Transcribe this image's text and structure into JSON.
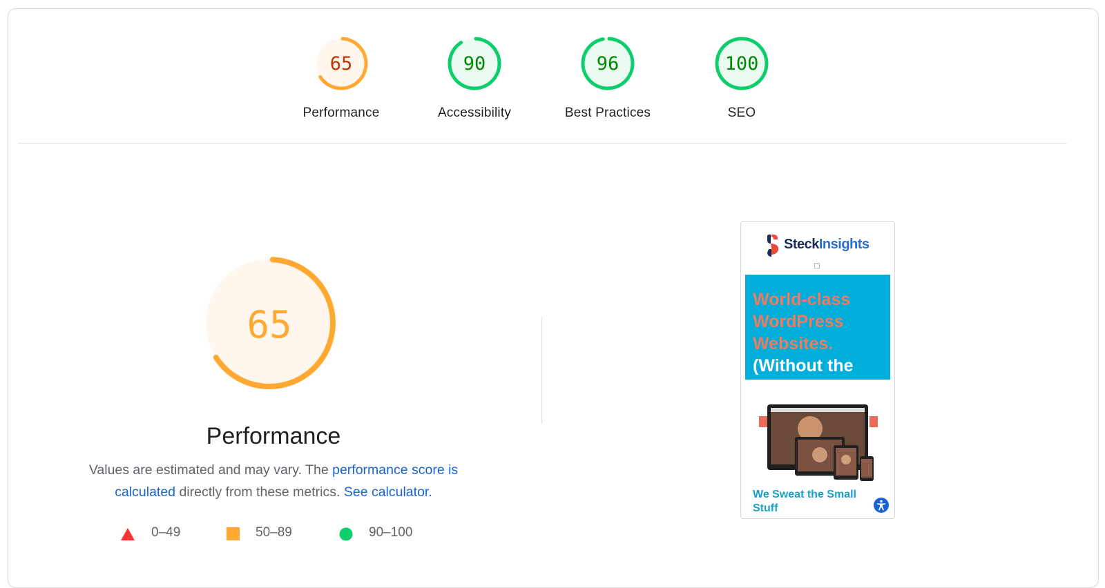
{
  "categories": [
    {
      "name": "Performance",
      "score": 65,
      "status": "average"
    },
    {
      "name": "Accessibility",
      "score": 90,
      "status": "pass"
    },
    {
      "name": "Best Practices",
      "score": 96,
      "status": "pass"
    },
    {
      "name": "SEO",
      "score": 100,
      "status": "pass"
    }
  ],
  "main": {
    "score": 65,
    "title": "Performance",
    "desc_prefix": "Values are estimated and may vary. The ",
    "desc_link": "performance score is calculated",
    "desc_middle": " directly from these metrics. ",
    "desc_calc_link": "See calculator.",
    "legend": [
      {
        "label": "0–49",
        "icon": "red-triangle-icon"
      },
      {
        "label": "50–89",
        "icon": "orange-square-icon"
      },
      {
        "label": "90–100",
        "icon": "green-circle-icon"
      }
    ]
  },
  "screenshot": {
    "logo_part1": "Steck",
    "logo_part2": "Insights",
    "hero_line_orange": "World-class\nWordPress\nWebsites.",
    "hero_line_white": "(Without the",
    "tagline": "We Sweat the Small Stuff"
  },
  "colors": {
    "average_stroke": "#ffa933",
    "average_fill": "#fff7ee",
    "average_text": "#c33300",
    "average_big_text": "#ffa933",
    "pass_stroke": "#0cce6b",
    "pass_fill": "#ebfbf2",
    "pass_text": "#008800",
    "fail": "#ff3333",
    "link": "#1a62d4"
  }
}
